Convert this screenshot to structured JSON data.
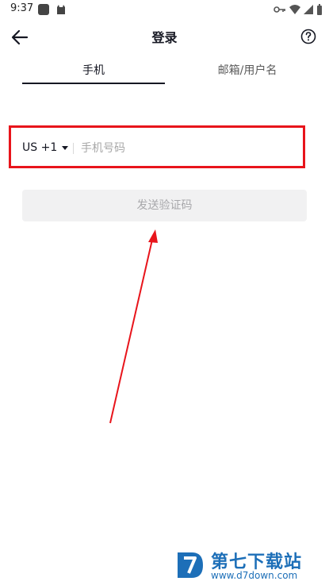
{
  "status_bar": {
    "time": "9:37"
  },
  "header": {
    "title": "登录"
  },
  "tabs": [
    {
      "label": "手机"
    },
    {
      "label": "邮箱/用户名"
    }
  ],
  "phone": {
    "country_code": "US +1",
    "placeholder": "手机号码"
  },
  "send_button": {
    "label": "发送验证码"
  },
  "watermark": {
    "name": "第七下载站",
    "url": "www.d7down.com"
  },
  "colors": {
    "highlight": "#e8141b",
    "accent": "#161823",
    "watermark": "#1d6fb8"
  }
}
